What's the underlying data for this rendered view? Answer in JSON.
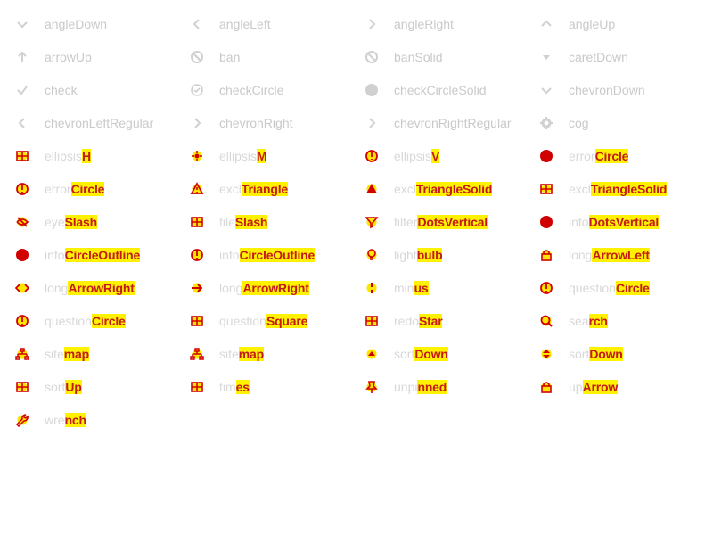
{
  "icons": [
    {
      "name": "angleDown",
      "style": "faint",
      "glyph": "angle-down"
    },
    {
      "name": "angleLeft",
      "style": "faint",
      "glyph": "angle-left"
    },
    {
      "name": "angleRight",
      "style": "faint",
      "glyph": "angle-right"
    },
    {
      "name": "angleUp",
      "style": "faint",
      "glyph": "angle-up"
    },
    {
      "name": "arrowUp",
      "style": "faint",
      "glyph": "arrow-up"
    },
    {
      "name": "ban",
      "style": "faint",
      "glyph": "ban"
    },
    {
      "name": "banSolid",
      "style": "faint",
      "glyph": "ban"
    },
    {
      "name": "caretDown",
      "style": "faint",
      "glyph": "caret-down"
    },
    {
      "name": "check",
      "style": "faint",
      "glyph": "check"
    },
    {
      "name": "checkCircle",
      "style": "faint",
      "glyph": "check-circle"
    },
    {
      "name": "checkCircleSolid",
      "style": "faint",
      "glyph": "check-circle-solid"
    },
    {
      "name": "chevronDown",
      "style": "faint",
      "glyph": "angle-down"
    },
    {
      "name": "chevronLeftRegular",
      "style": "faint",
      "glyph": "angle-left"
    },
    {
      "name": "chevronRight",
      "style": "faint",
      "glyph": "angle-right"
    },
    {
      "name": "chevronRightRegular",
      "style": "faint",
      "glyph": "angle-right"
    },
    {
      "name": "cog",
      "style": "faint",
      "glyph": "cog"
    },
    {
      "name": "ellipsisH",
      "style": "hot",
      "glyph": "grid"
    },
    {
      "name": "ellipsisM",
      "style": "hot",
      "glyph": "dot"
    },
    {
      "name": "ellipsisV",
      "style": "hot",
      "glyph": "circle"
    },
    {
      "name": "errorCircle",
      "style": "hot",
      "glyph": "circle-solid"
    },
    {
      "name": "errorCircle",
      "style": "hot",
      "glyph": "circle"
    },
    {
      "name": "exclTriangle",
      "style": "hot",
      "glyph": "triangle"
    },
    {
      "name": "exclTriangleSolid",
      "style": "hot",
      "glyph": "triangle-solid"
    },
    {
      "name": "exclTriangleSolid",
      "style": "hot",
      "glyph": "grid"
    },
    {
      "name": "eyeSlash",
      "style": "hot",
      "glyph": "slash"
    },
    {
      "name": "fileSlash",
      "style": "hot",
      "glyph": "grid"
    },
    {
      "name": "filterDotsVertical",
      "style": "hot",
      "glyph": "filter"
    },
    {
      "name": "infoDotsVertical",
      "style": "hot",
      "glyph": "circle-solid"
    },
    {
      "name": "infoCircleOutline",
      "style": "hot",
      "glyph": "circle-solid"
    },
    {
      "name": "infoCircleOutline",
      "style": "hot",
      "glyph": "circle"
    },
    {
      "name": "lightbulb",
      "style": "hot",
      "glyph": "bulb"
    },
    {
      "name": "longArrowLeft",
      "style": "hot",
      "glyph": "lock"
    },
    {
      "name": "longArrowRight",
      "style": "hot",
      "glyph": "code"
    },
    {
      "name": "longArrowRight",
      "style": "hot",
      "glyph": "arrow-right"
    },
    {
      "name": "minus",
      "style": "hot",
      "glyph": "vbar"
    },
    {
      "name": "questionCircle",
      "style": "hot",
      "glyph": "circle"
    },
    {
      "name": "questionCircle",
      "style": "hot",
      "glyph": "circle"
    },
    {
      "name": "questionSquare",
      "style": "hot",
      "glyph": "grid"
    },
    {
      "name": "redoStar",
      "style": "hot",
      "glyph": "grid"
    },
    {
      "name": "search",
      "style": "hot",
      "glyph": "search"
    },
    {
      "name": "sitemap",
      "style": "hot",
      "glyph": "sitemap"
    },
    {
      "name": "sitemap",
      "style": "hot",
      "glyph": "sitemap"
    },
    {
      "name": "sortDown",
      "style": "hot",
      "glyph": "caret-up"
    },
    {
      "name": "sortDown",
      "style": "hot",
      "glyph": "sort"
    },
    {
      "name": "sortUp",
      "style": "hot",
      "glyph": "grid"
    },
    {
      "name": "times",
      "style": "hot",
      "glyph": "grid"
    },
    {
      "name": "unpinned",
      "style": "hot",
      "glyph": "pin"
    },
    {
      "name": "upArrow",
      "style": "hot",
      "glyph": "lock"
    },
    {
      "name": "wrench",
      "style": "hot",
      "glyph": "wrench"
    }
  ]
}
